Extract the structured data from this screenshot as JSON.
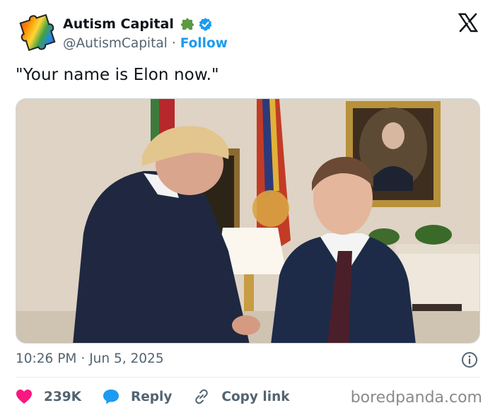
{
  "header": {
    "avatar_icon": "rainbow-puzzle-piece-icon",
    "display_name": "Autism Capital",
    "display_name_icon": "green-puzzle-piece-icon",
    "verified_icon": "verified-badge-icon",
    "handle": "@AutismCapital",
    "separator": "·",
    "follow_label": "Follow",
    "close_icon": "x-logo-icon"
  },
  "tweet": {
    "text": "\"Your name is Elon now.\"",
    "image_description_icon": "photo-icon"
  },
  "meta": {
    "time": "10:26 PM",
    "separator": "·",
    "date": "Jun 5, 2025",
    "info_icon": "info-icon"
  },
  "actions": {
    "like_icon": "heart-icon",
    "like_count": "239K",
    "reply_icon": "reply-bubble-icon",
    "reply_label": "Reply",
    "copy_icon": "link-icon",
    "copy_label": "Copy link"
  },
  "watermark": "boredpanda.com",
  "colors": {
    "accent": "#1d9bf0",
    "like": "#f91880",
    "text": "#0f1419",
    "muted": "#536471"
  }
}
